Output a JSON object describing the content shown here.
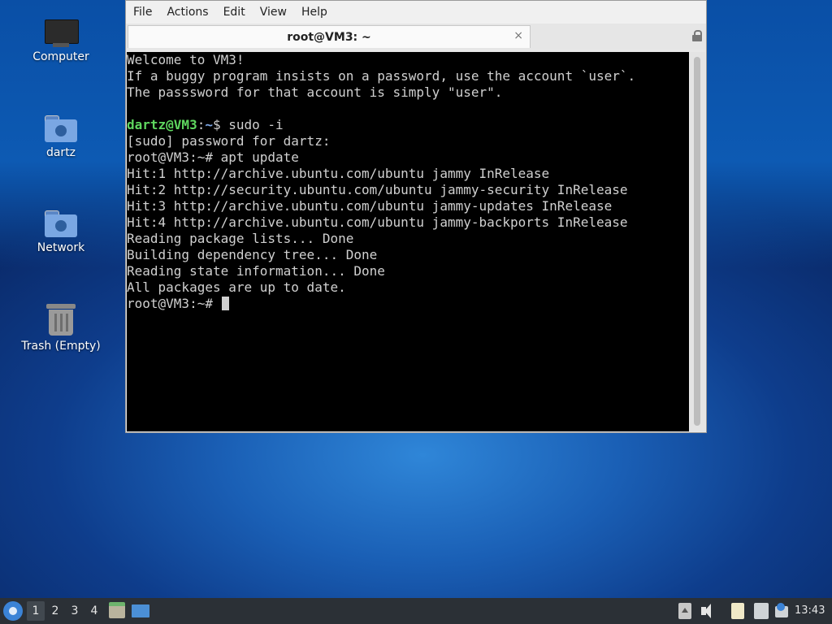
{
  "desktop": {
    "icons": [
      {
        "label": "Computer",
        "icon": "computer-icon"
      },
      {
        "label": "dartz",
        "icon": "home-folder-icon"
      },
      {
        "label": "Network",
        "icon": "network-folder-icon"
      },
      {
        "label": "Trash (Empty)",
        "icon": "trash-icon"
      }
    ]
  },
  "window": {
    "menu": [
      "File",
      "Actions",
      "Edit",
      "View",
      "Help"
    ],
    "tab_title": "root@VM3: ~",
    "tab_close": "×",
    "terminal": {
      "lines": [
        "Welcome to VM3!",
        "If a buggy program insists on a password, use the account `user`.",
        "The passsword for that account is simply \"user\".",
        "",
        "[sudo] password for dartz:",
        "root@VM3:~# apt update",
        "Hit:1 http://archive.ubuntu.com/ubuntu jammy InRelease",
        "Hit:2 http://security.ubuntu.com/ubuntu jammy-security InRelease",
        "Hit:3 http://archive.ubuntu.com/ubuntu jammy-updates InRelease",
        "Hit:4 http://archive.ubuntu.com/ubuntu jammy-backports InRelease",
        "Reading package lists... Done",
        "Building dependency tree... Done",
        "Reading state information... Done",
        "All packages are up to date.",
        "root@VM3:~# "
      ],
      "prompt_user": "dartz@VM3",
      "prompt_colon": ":",
      "prompt_path": "~",
      "prompt_cmd": "$ sudo -i"
    }
  },
  "taskbar": {
    "workspaces": [
      "1",
      "2",
      "3",
      "4"
    ],
    "active_workspace": "1",
    "clock": "13:43"
  },
  "colors": {
    "terminal_bg": "#000000",
    "prompt_green": "#5fd75f",
    "prompt_blue": "#7ea8e6",
    "taskbar_bg": "#2b3036"
  }
}
